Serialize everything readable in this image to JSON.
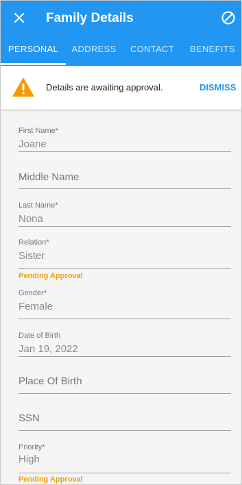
{
  "header": {
    "title": "Family Details",
    "close_icon": "close-icon",
    "action_icon": "block-icon",
    "bg_color": "#2196f3"
  },
  "tabs": [
    {
      "label": "PERSONAL",
      "active": true
    },
    {
      "label": "ADDRESS",
      "active": false
    },
    {
      "label": "CONTACT",
      "active": false
    },
    {
      "label": "BENEFITS",
      "active": false
    }
  ],
  "banner": {
    "icon": "warning-icon",
    "message": "Details are awaiting approval.",
    "dismiss_label": "DISMISS",
    "warning_color": "#f59a00"
  },
  "form": {
    "first_name": {
      "label": "First Name*",
      "value": "Joane"
    },
    "middle_name": {
      "placeholder": "Middle Name"
    },
    "last_name": {
      "label": "Last Name*",
      "value": "Nona"
    },
    "relation": {
      "label": "Relation*",
      "value": "Sister",
      "status": "Pending Approval"
    },
    "gender": {
      "label": "Gender*",
      "value": "Female"
    },
    "date_of_birth": {
      "label": "Date of Birth",
      "value": "Jan 19, 2022"
    },
    "place_of_birth": {
      "placeholder": "Place Of Birth"
    },
    "ssn": {
      "placeholder": "SSN"
    },
    "priority": {
      "label": "Priority*",
      "value": "High",
      "status": "Pending Approval"
    }
  }
}
